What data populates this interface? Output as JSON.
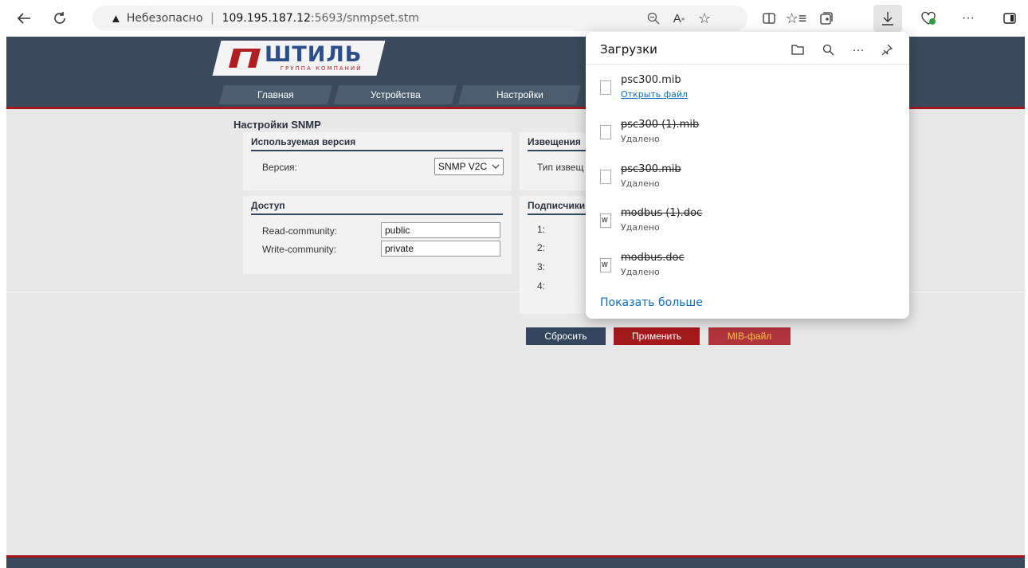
{
  "browser": {
    "security_label": "Небезопасно",
    "url_host": "109.195.187.12",
    "url_path": ":5693/snmpset.stm",
    "icons": [
      "back-icon",
      "reload-icon",
      "warning-icon",
      "zoom-icon",
      "read-aloud-icon",
      "favorite-icon",
      "split-screen-icon",
      "favorites-list-icon",
      "collections-icon",
      "download-icon",
      "performance-icon",
      "more-icon",
      "sidebar-icon"
    ]
  },
  "site": {
    "logo_word": "ШТИЛЬ",
    "logo_sub": "ГРУППА КОМПАНИЙ",
    "nav": [
      "Главная",
      "Устройства",
      "Настройки"
    ]
  },
  "page": {
    "title": "Настройки SNMP",
    "version_panel": {
      "heading": "Используемая версия",
      "label": "Версия:",
      "value": "SNMP V2C"
    },
    "notify_panel": {
      "heading": "Извещения",
      "label": "Тип извещ"
    },
    "access_panel": {
      "heading": "Доступ",
      "read_label": "Read-community:",
      "read_value": "public",
      "write_label": "Write-community:",
      "write_value": "private"
    },
    "subscribers_panel": {
      "heading": "Подписчики",
      "rows": [
        "1:",
        "2:",
        "3:",
        "4:"
      ]
    },
    "buttons": {
      "reset": "Сбросить",
      "apply": "Применить",
      "mib": "MIB-файл"
    }
  },
  "downloads": {
    "title": "Загрузки",
    "items": [
      {
        "name": "psc300.mib",
        "status": "Открыть файл",
        "deleted": false
      },
      {
        "name": "psc300 (1).mib",
        "status": "Удалено",
        "deleted": true
      },
      {
        "name": "psc300.mib",
        "status": "Удалено",
        "deleted": true
      },
      {
        "name": "modbus (1).doc",
        "status": "Удалено",
        "deleted": true
      },
      {
        "name": "modbus.doc",
        "status": "Удалено",
        "deleted": true
      }
    ],
    "show_more": "Показать больше"
  },
  "colors": {
    "header": "#3a4a5c",
    "accent_red": "#a3191c",
    "link_blue": "#0f6cbd",
    "mib_button_text": "#f5c242"
  }
}
